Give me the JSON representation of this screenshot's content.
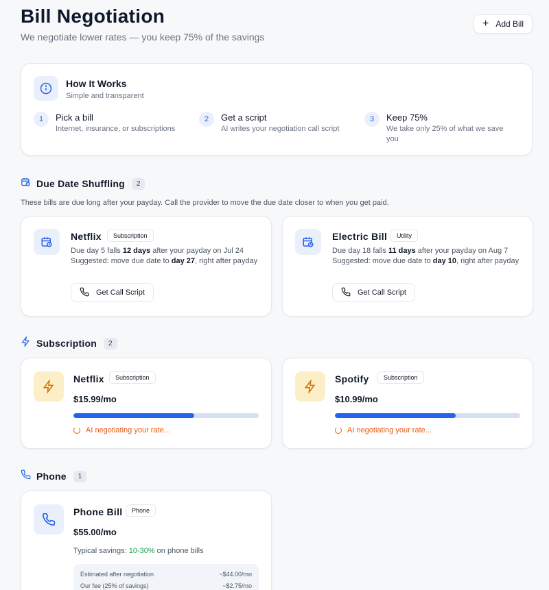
{
  "header": {
    "title": "Bill Negotiation",
    "subtitle": "We negotiate lower rates — you keep 75% of the savings",
    "add_bill_label": "Add Bill"
  },
  "how_it_works": {
    "title": "How It Works",
    "subtitle": "Simple and transparent",
    "steps": [
      {
        "num": "1",
        "title": "Pick a bill",
        "desc": "Internet, insurance, or subscriptions"
      },
      {
        "num": "2",
        "title": "Get a script",
        "desc": "AI writes your negotiation call script"
      },
      {
        "num": "3",
        "title": "Keep 75%",
        "desc": "We take only 25% of what we save you"
      }
    ]
  },
  "due_date": {
    "title": "Due Date Shuffling",
    "count": "2",
    "note": "These bills are due long after your payday. Call the provider to move the due date closer to when you get paid.",
    "cards": [
      {
        "name": "Netflix",
        "tag": "Subscription",
        "line1_a": "Due day 5 falls ",
        "line1_b": "12 days",
        "line1_c": " after your payday on Jul 24",
        "line2_a": "Suggested: move due date to ",
        "line2_b": "day 27",
        "line2_c": ", right after payday",
        "button": "Get Call Script"
      },
      {
        "name": "Electric Bill",
        "tag": "Utility",
        "line1_a": "Due day 18 falls ",
        "line1_b": "11 days",
        "line1_c": " after your payday on Aug 7",
        "line2_a": "Suggested: move due date to ",
        "line2_b": "day 10",
        "line2_c": ", right after payday",
        "button": "Get Call Script"
      }
    ]
  },
  "subscription": {
    "title": "Subscription",
    "count": "2",
    "cards": [
      {
        "name": "Netflix",
        "tag": "Subscription",
        "price": "$15.99/mo",
        "progress": 0.65,
        "status": "AI negotiating your rate..."
      },
      {
        "name": "Spotify",
        "tag": "Subscription",
        "price": "$10.99/mo",
        "progress": 0.65,
        "status": "AI negotiating your rate..."
      }
    ]
  },
  "phone": {
    "title": "Phone",
    "count": "1",
    "card": {
      "name": "Phone Bill",
      "tag": "Phone",
      "price": "$55.00/mo",
      "typical_a": "Typical savings: ",
      "typical_b": "10-30%",
      "typical_c": " on phone bills",
      "rows": [
        {
          "label": "Estimated after negotiation",
          "value": "~$44.00/mo"
        },
        {
          "label": "Our fee (25% of savings)",
          "value": "~$2.75/mo"
        }
      ]
    }
  },
  "colors": {
    "accent": "#2563eb",
    "orange": "#ea580c",
    "green": "#16a34a"
  }
}
